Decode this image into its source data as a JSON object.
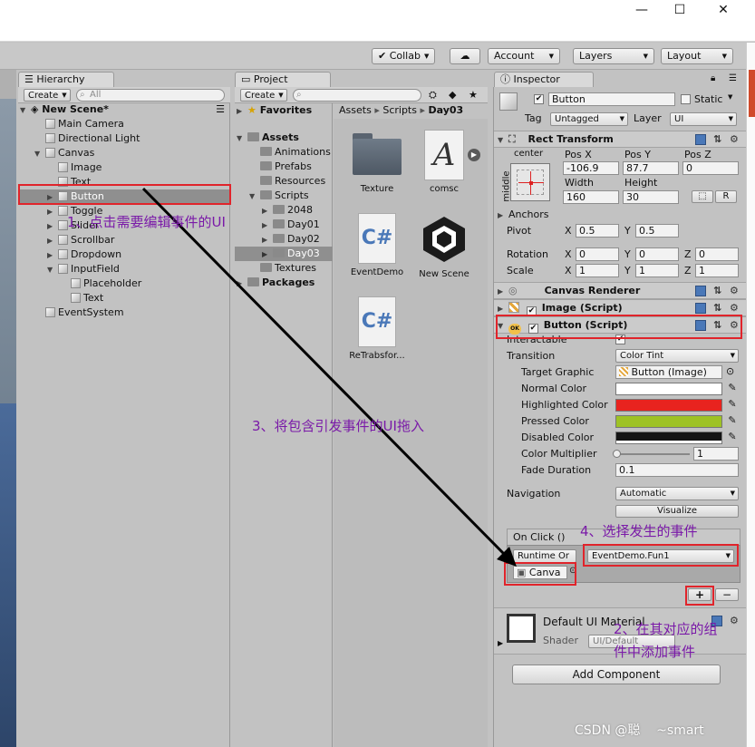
{
  "window": {
    "min_glyph": "—",
    "max_glyph": "☐",
    "close_glyph": "✕"
  },
  "toolbar": {
    "collab": "Collab",
    "cloud_icon": "cloud-icon",
    "account": "Account",
    "layers": "Layers",
    "layout": "Layout"
  },
  "hierarchy": {
    "tab": "Hierarchy",
    "create": "Create",
    "search_placeholder": "All",
    "scene": "New Scene*",
    "items": [
      {
        "label": "Main Camera",
        "depth": 1
      },
      {
        "label": "Directional Light",
        "depth": 1
      },
      {
        "label": "Canvas",
        "depth": 1
      },
      {
        "label": "Image",
        "depth": 2
      },
      {
        "label": "Text",
        "depth": 2
      },
      {
        "label": "Button",
        "depth": 2
      },
      {
        "label": "Toggle",
        "depth": 2
      },
      {
        "label": "Slider",
        "depth": 2
      },
      {
        "label": "Scrollbar",
        "depth": 2
      },
      {
        "label": "Dropdown",
        "depth": 2
      },
      {
        "label": "InputField",
        "depth": 2
      },
      {
        "label": "Placeholder",
        "depth": 3
      },
      {
        "label": "Text",
        "depth": 3
      },
      {
        "label": "EventSystem",
        "depth": 1
      }
    ]
  },
  "project": {
    "tab": "Project",
    "create": "Create",
    "favorites": "Favorites",
    "assets": "Assets",
    "folders": [
      "Animations",
      "Prefabs",
      "Resources",
      "Scripts",
      "2048",
      "Day01",
      "Day02",
      "Day03",
      "Textures"
    ],
    "packages": "Packages",
    "breadcrumb": [
      "Assets",
      "Scripts",
      "Day03"
    ],
    "files": [
      "Texture",
      "comsc",
      "EventDemo",
      "New Scene",
      "ReTrabsfor..."
    ]
  },
  "inspector": {
    "tab": "Inspector",
    "object_name": "Button",
    "static_label": "Static",
    "tag_label": "Tag",
    "tag_value": "Untagged",
    "layer_label": "Layer",
    "layer_value": "UI",
    "rect_transform": {
      "title": "Rect Transform",
      "anchor_h": "center",
      "anchor_v": "middle",
      "posx_label": "Pos X",
      "posy_label": "Pos Y",
      "posz_label": "Pos Z",
      "posx": "-106.9",
      "posy": "87.7",
      "posz": "0",
      "width_label": "Width",
      "height_label": "Height",
      "width": "160",
      "height": "30",
      "raw_label": "R",
      "anchors_label": "Anchors",
      "pivot_label": "Pivot",
      "pivot_x": "0.5",
      "pivot_y": "0.5",
      "rotation_label": "Rotation",
      "rot_x": "0",
      "rot_y": "0",
      "rot_z": "0",
      "scale_label": "Scale",
      "scale_x": "1",
      "scale_y": "1",
      "scale_z": "1",
      "x": "X",
      "y": "Y",
      "z": "Z"
    },
    "canvas_renderer": "Canvas Renderer",
    "image_script": "Image (Script)",
    "button_script": {
      "title": "Button (Script)",
      "interactable_label": "Interactable",
      "transition_label": "Transition",
      "transition_value": "Color Tint",
      "target_graphic_label": "Target Graphic",
      "target_graphic_value": "Button (Image)",
      "normal_label": "Normal Color",
      "highlighted_label": "Highlighted Color",
      "pressed_label": "Pressed Color",
      "disabled_label": "Disabled Color",
      "multiplier_label": "Color Multiplier",
      "multiplier_value": "1",
      "fade_label": "Fade Duration",
      "fade_value": "0.1",
      "navigation_label": "Navigation",
      "navigation_value": "Automatic",
      "visualize": "Visualize",
      "onclick_label": "On Click ()",
      "runtime_value": "Runtime Or",
      "function_value": "EventDemo.Fun1",
      "object_value": "Canva",
      "add_glyph": "+",
      "remove_glyph": "−"
    },
    "material": {
      "name": "Default UI Material",
      "shader_label": "Shader",
      "shader_value": "UI/Default"
    },
    "add_component": "Add Component"
  },
  "colors": {
    "normal": "#ffffff",
    "highlighted": "#e8231f",
    "pressed": "#9ec225",
    "disabled": "#141414",
    "annotation": "#7a1aa8",
    "highlight_box": "#e0242b"
  },
  "annotations": {
    "step1": "1、点击需要编辑事件的UI",
    "step2_line1": "2、在其对应的组",
    "step2_line2": "件中添加事件",
    "step3": "3、将包含引发事件的UI拖入",
    "step4": "4、选择发生的事件"
  },
  "watermark": "CSDN @聪    ~smart"
}
